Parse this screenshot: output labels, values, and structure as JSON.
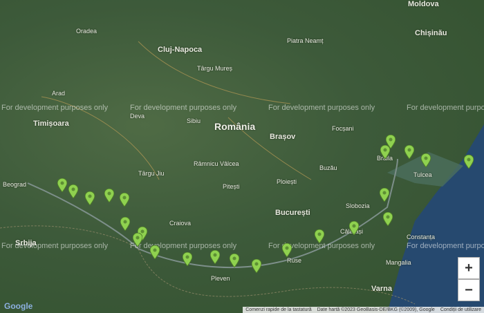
{
  "labels": {
    "country": "România",
    "bucharest": "București",
    "cluj": "Cluj-Napoca",
    "timisoara": "Timișoara",
    "brasov": "Brașov",
    "chisinau": "Chișinău",
    "oradea": "Oradea",
    "sibiu": "Sibiu",
    "craiova": "Craiova",
    "ploiesti": "Ploiești",
    "constanta": "Constanța",
    "varna": "Varna",
    "ruse": "Ruse",
    "pitesti": "Pitești",
    "targu_mures": "Târgu Mureș",
    "tulcea": "Tulcea",
    "braila": "Brăila",
    "beograd": "Beograd",
    "pleven": "Pleven",
    "srbija": "Srbija",
    "piatra_neamt": "Piatra Neamț",
    "arad": "Arad",
    "deva": "Deva",
    "targu_jiu": "Târgu Jiu",
    "ramnicu_valcea": "Râmnicu Vâlcea",
    "focsani": "Focșani",
    "buzau": "Buzău",
    "slobozia": "Slobozia",
    "calarasi": "Călărași",
    "mangalia": "Mangalia",
    "moldova": "Moldova"
  },
  "watermark": "For development purposes only",
  "zoom": {
    "in": "+",
    "out": "−"
  },
  "attribution": {
    "shortcuts": "Comenzi rapide de la tastatură",
    "mapdata": "Date hartă ©2023 GeoBasis-DE/BKG (©2009), Google",
    "terms": "Condiții de utilizare"
  },
  "logo": "Google",
  "marker_color": "#8fd14f"
}
